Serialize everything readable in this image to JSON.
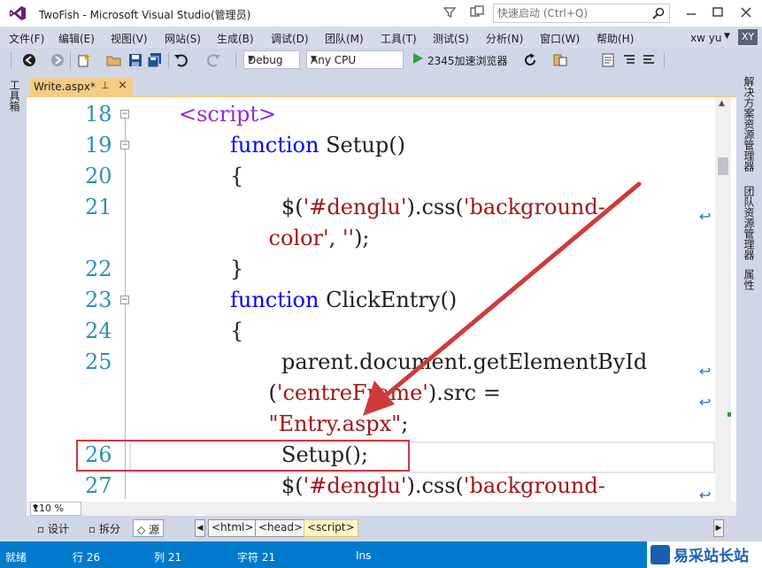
{
  "window": {
    "title": "TwoFish - Microsoft Visual Studio(管理员)",
    "quick_launch_placeholder": "快速启动 (Ctrl+Q)"
  },
  "menu": {
    "items": [
      "文件(F)",
      "编辑(E)",
      "视图(V)",
      "网站(S)",
      "生成(B)",
      "调试(D)",
      "团队(M)",
      "工具(T)",
      "测试(S)",
      "分析(N)",
      "窗口(W)",
      "帮助(H)"
    ],
    "user": "xw yu",
    "avatar_initials": "XY"
  },
  "toolbar": {
    "config": "Debug",
    "platform": "Any CPU",
    "run_target": "2345加速浏览器"
  },
  "side_panels": {
    "left": "工具箱",
    "right": [
      "解决方案资源管理器",
      "团队资源管理器",
      "属性"
    ]
  },
  "tab": {
    "label": "Write.aspx*",
    "pin": "⊥",
    "close": "×"
  },
  "code": {
    "lines": [
      {
        "no": "18",
        "indent": 1,
        "text": "<script>",
        "kind": "tag",
        "fold": true
      },
      {
        "no": "19",
        "indent": 2,
        "segments": [
          {
            "t": "function",
            "k": "kw"
          },
          {
            "t": " Setup()",
            "k": "plain"
          }
        ],
        "fold": true
      },
      {
        "no": "20",
        "indent": 2,
        "segments": [
          {
            "t": "{",
            "k": "plain"
          }
        ]
      },
      {
        "no": "21",
        "indent": 3,
        "segments": [
          {
            "t": "$(",
            "k": "plain"
          },
          {
            "t": "'#denglu'",
            "k": "str"
          },
          {
            "t": ").css(",
            "k": "plain"
          },
          {
            "t": "'background-",
            "k": "str"
          }
        ],
        "wrap": true
      },
      {
        "no": "",
        "indent": 2.75,
        "segments": [
          {
            "t": "color'",
            "k": "str"
          },
          {
            "t": ", ",
            "k": "plain"
          },
          {
            "t": "''",
            "k": "str"
          },
          {
            "t": ");",
            "k": "plain"
          }
        ]
      },
      {
        "no": "22",
        "indent": 2,
        "segments": [
          {
            "t": "}",
            "k": "plain"
          }
        ]
      },
      {
        "no": "23",
        "indent": 2,
        "segments": [
          {
            "t": "function",
            "k": "kw"
          },
          {
            "t": " ClickEntry()",
            "k": "plain"
          }
        ],
        "fold": true
      },
      {
        "no": "24",
        "indent": 2,
        "segments": [
          {
            "t": "{",
            "k": "plain"
          }
        ]
      },
      {
        "no": "25",
        "indent": 3,
        "segments": [
          {
            "t": "parent.document.getElementById",
            "k": "plain"
          }
        ],
        "wrap": true
      },
      {
        "no": "",
        "indent": 2.75,
        "segments": [
          {
            "t": "(",
            "k": "plain"
          },
          {
            "t": "'centreFrame'",
            "k": "str"
          },
          {
            "t": ").src =",
            "k": "plain"
          }
        ],
        "wrap": true
      },
      {
        "no": "",
        "indent": 2.75,
        "segments": [
          {
            "t": "\"Entry.aspx\"",
            "k": "str"
          },
          {
            "t": ";",
            "k": "plain"
          }
        ]
      },
      {
        "no": "26",
        "indent": 3,
        "segments": [
          {
            "t": "Setup();",
            "k": "plain"
          }
        ]
      },
      {
        "no": "27",
        "indent": 3,
        "segments": [
          {
            "t": "$(",
            "k": "plain"
          },
          {
            "t": "'#denglu'",
            "k": "str"
          },
          {
            "t": ").css(",
            "k": "plain"
          },
          {
            "t": "'background-",
            "k": "str"
          }
        ],
        "wrap": true
      }
    ]
  },
  "editor_footer": {
    "zoom": "110 %"
  },
  "view_bar": {
    "design": "设计",
    "split": "拆分",
    "source": "源",
    "crumbs": [
      "<html>",
      "<head>",
      "<script>"
    ]
  },
  "status": {
    "ready": "就绪",
    "line": "行 26",
    "col": "列 21",
    "char": "字符 21",
    "mode": "Ins"
  },
  "watermark": {
    "text": "易采站长站"
  },
  "colors": {
    "status_bar": "#007acc",
    "tab_active": "#f5cc84",
    "highlight": "#d03a3a",
    "keyword": "#0000ff",
    "string": "#a31515",
    "line_number": "#2b91af"
  }
}
